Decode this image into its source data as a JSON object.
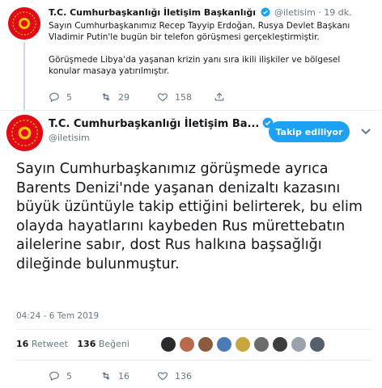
{
  "tweet1": {
    "account_name": "T.C. Cumhurbaşkanlığı İletişim Başkanlığı",
    "handle": "@iletisim",
    "separator": "·",
    "time": "19 dk.",
    "paragraph1": "Sayın Cumhurbaşkanımız Recep Tayyip Erdoğan, Rusya Devlet Başkanı Vladimir Putin'le bugün bir telefon görüşmesi gerçekleştirmiştir.",
    "paragraph2": "Görüşmede Libya'da yaşanan krizin yanı sıra ikili ilişkiler ve bölgesel konular masaya yatırılmıştır.",
    "replies": "5",
    "retweets": "29",
    "likes": "158"
  },
  "tweet2": {
    "account_name": "T.C. Cumhurbaşkanlığı İletişim Ba...",
    "handle": "@iletisim",
    "follow_label": "Takip ediliyor",
    "text": "Sayın Cumhurbaşkanımız görüşmede ayrıca Barents Denizi'nde yaşanan denizaltı kazasını büyük üzüntüyle takip ettiğini belirterek, bu elim olayda hayatlarını kaybeden Rus mürettebatın ailelerine sabır, dost Rus halkına başsağlığı dileğinde bulunmuştur.",
    "timestamp": "04:24 - 6 Tem 2019",
    "retweet_count": "16",
    "retweet_label": "Retweet",
    "like_count": "136",
    "like_label": "Beğeni",
    "replies": "5",
    "retweets": "16",
    "likes": "136"
  },
  "colors": {
    "brand_blue": "#1da1f2",
    "emblem_red": "#e30a17",
    "muted_gray": "#657786"
  },
  "icons": [
    "reply-icon",
    "retweet-icon",
    "like-icon",
    "verified-icon",
    "chevron-down-icon"
  ]
}
